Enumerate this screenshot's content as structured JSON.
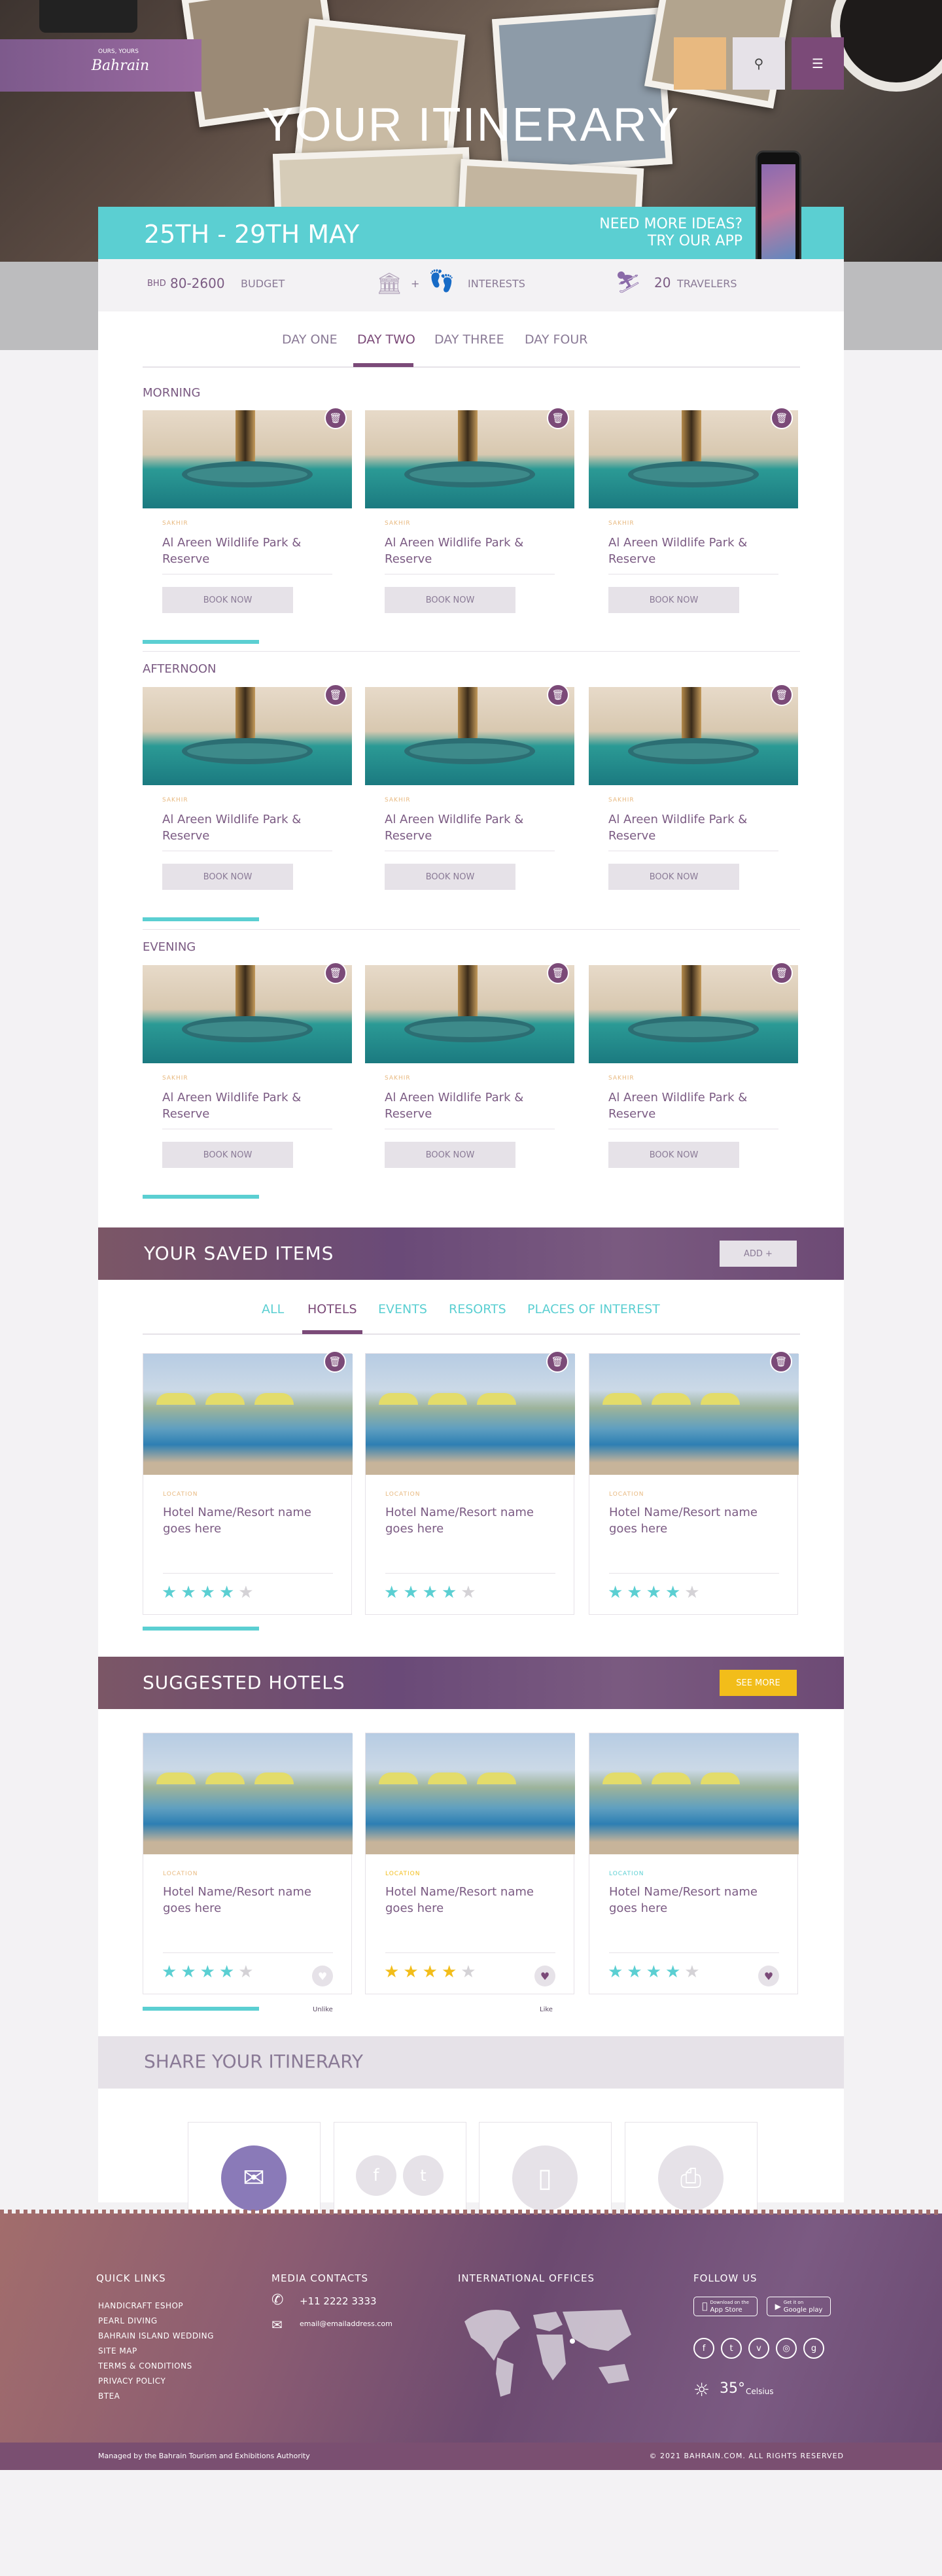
{
  "hero": {
    "logo_small": "OURS, YOURS",
    "logo_text": "Bahrain",
    "title": "YOUR ITINERARY",
    "search_icon": "search-icon",
    "menu_icon": "menu-icon",
    "colors": {
      "orange": "#e8b980",
      "light": "#e6e2e8",
      "purple": "#7b4a78"
    }
  },
  "date_bar": {
    "dates": "25TH - 29TH MAY",
    "ideas_line1": "NEED MORE IDEAS?",
    "ideas_line2": "TRY OUR APP"
  },
  "info_bar": {
    "currency": "BHD",
    "budget_value": "80-2600",
    "budget_label": "BUDGET",
    "plus": "+",
    "interests_label": "INTERESTS",
    "travelers_value": "20",
    "travelers_label": "TRAVELERS"
  },
  "day_tabs": [
    "DAY ONE",
    "DAY TWO",
    "DAY THREE",
    "DAY FOUR"
  ],
  "active_day": "DAY TWO",
  "slots": [
    {
      "label": "MORNING"
    },
    {
      "label": "AFTERNOON"
    },
    {
      "label": "EVENING"
    }
  ],
  "activity": {
    "location": "SAKHIR",
    "name": "Al Areen Wildlife Park & Reserve",
    "book_label": "BOOK NOW"
  },
  "saved": {
    "title": "YOUR SAVED ITEMS",
    "add_label": "ADD +",
    "tabs": [
      "ALL",
      "HOTELS",
      "EVENTS",
      "RESORTS",
      "PLACES OF INTEREST"
    ],
    "active_tab": "HOTELS"
  },
  "hotel": {
    "location": "LOCATION",
    "name": "Hotel Name/Resort name goes here",
    "rating": 4,
    "max_rating": 5
  },
  "suggested": {
    "title": "SUGGESTED HOTELS",
    "see_more": "SEE MORE",
    "unlike_label": "Unlike",
    "like_label": "Like"
  },
  "share": {
    "title": "SHARE YOUR ITINERARY"
  },
  "footer": {
    "quick_links_title": "QUICK LINKS",
    "quick_links": [
      "HANDICRAFT ESHOP",
      "PEARL DIVING",
      "BAHRAIN ISLAND WEDDING",
      "SITE MAP",
      "TERMS & CONDITIONS",
      "PRIVACY POLICY",
      "BTEA"
    ],
    "media_title": "MEDIA CONTACTS",
    "phone": "+11 2222 3333",
    "email": "email@emailaddress.com",
    "offices_title": "INTERNATIONAL OFFICES",
    "follow_title": "FOLLOW US",
    "app_store_small": "Download on the",
    "app_store": "App Store",
    "google_play_small": "Get it on",
    "google_play": "Google play",
    "temperature": "35°",
    "temperature_unit": "Celsius",
    "managed_by": "Managed by the Bahrain Tourism and Exhibitions Authority",
    "copyright": "© 2021 BAHRAIN.COM. ALL RIGHTS RESERVED"
  }
}
